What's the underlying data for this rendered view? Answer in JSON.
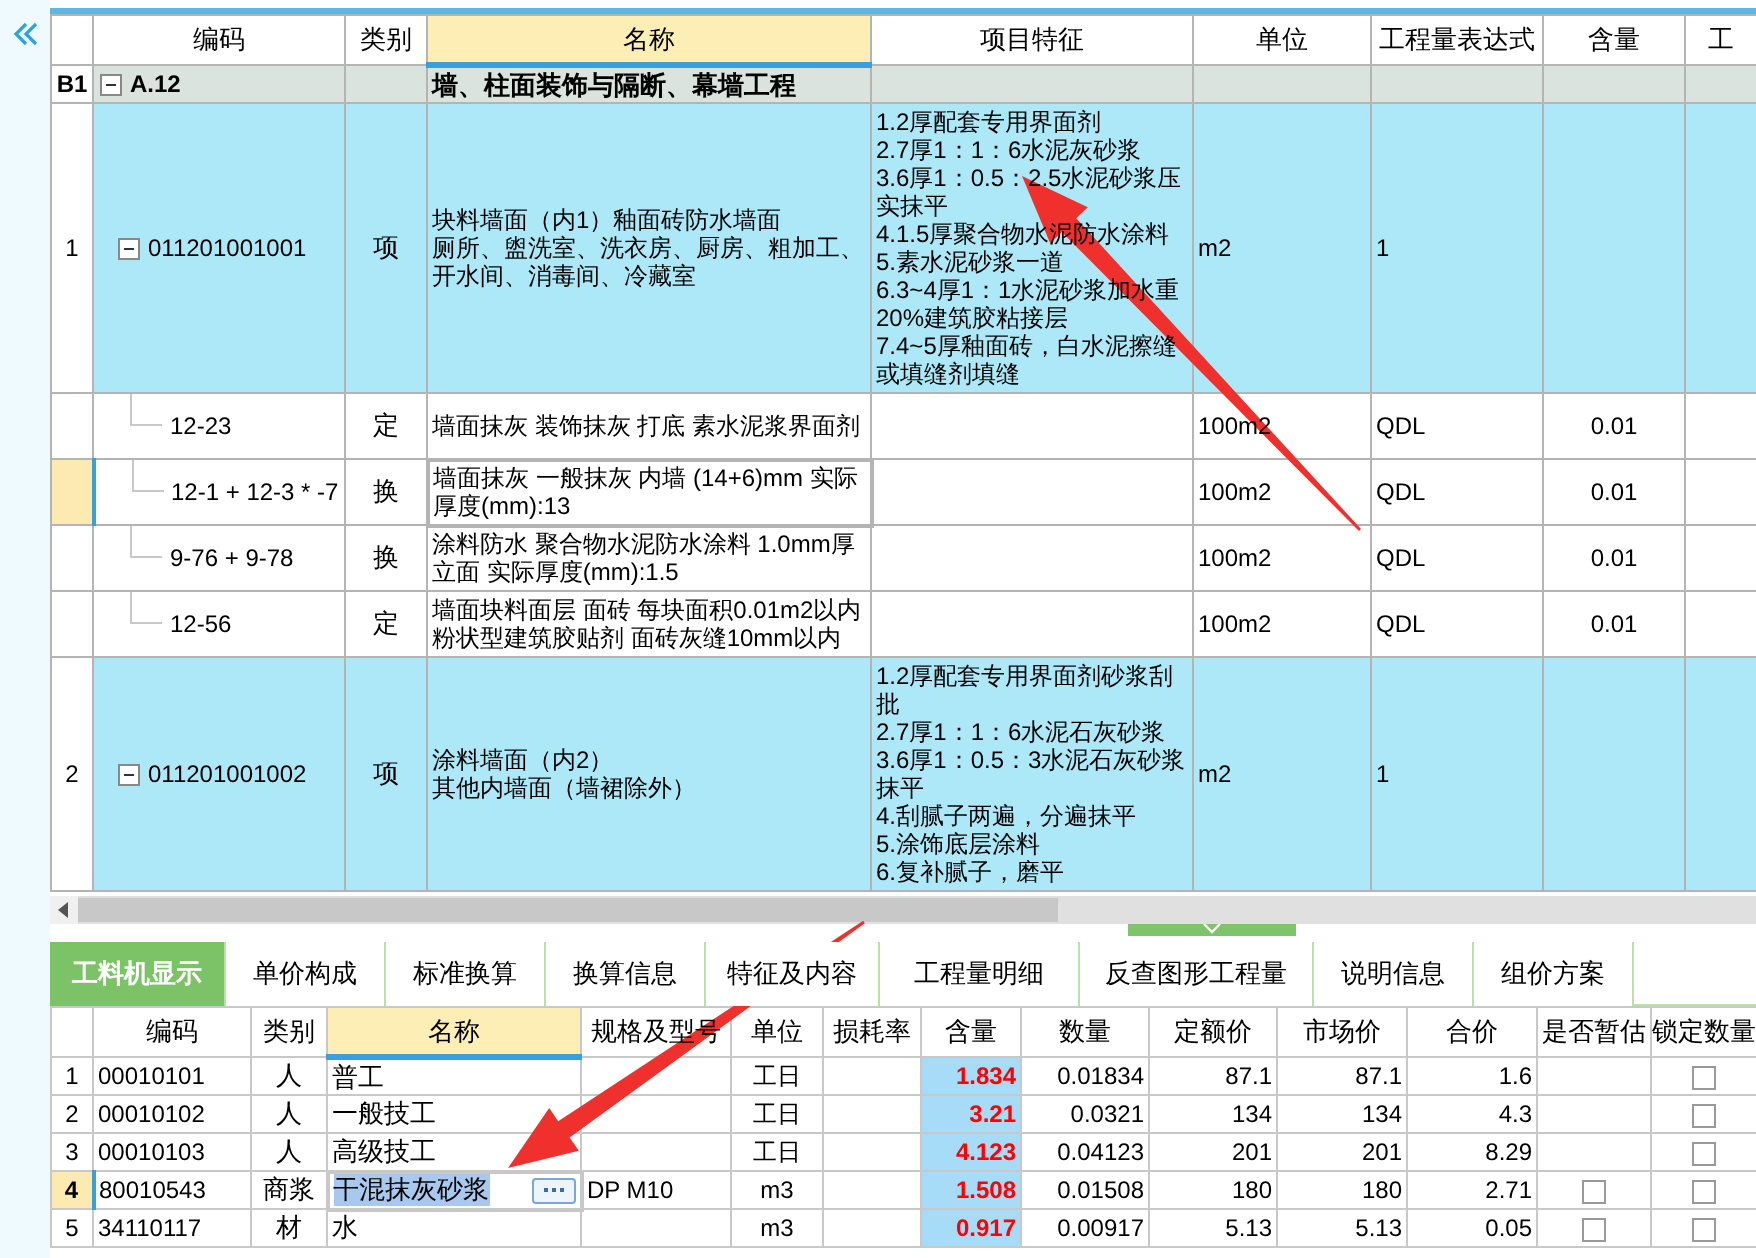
{
  "top_grid": {
    "columns": [
      {
        "selected": false
      },
      {
        "label": "编码",
        "selected": false
      },
      {
        "label": "类别",
        "selected": false
      },
      {
        "label": "名称",
        "selected": true
      },
      {
        "label": "项目特征",
        "selected": false
      },
      {
        "label": "单位",
        "selected": false
      },
      {
        "label": "工程量表达式",
        "selected": false
      },
      {
        "label": "含量",
        "selected": false
      },
      {
        "label": "工",
        "selected": false
      }
    ],
    "rows": [
      {
        "kind": "section",
        "number": "B1",
        "code": "A.12",
        "expanded": true,
        "type": "",
        "name": [
          "墙、柱面装饰与隔断、幕墙工程"
        ],
        "features": [],
        "unit": "",
        "expression": "",
        "content": "",
        "selected": false
      },
      {
        "kind": "item",
        "number": "1",
        "code": "011201001001",
        "expanded": true,
        "type": "项",
        "name": [
          "块料墙面（内1）釉面砖防水墙面",
          "厕所、盥洗室、洗衣房、厨房、粗加工、开水间、消毒间、冷藏室"
        ],
        "features": [
          "1.2厚配套专用界面剂",
          "2.7厚1：1：6水泥灰砂浆",
          "3.6厚1：0.5：2.5水泥砂浆压实抹平",
          "4.1.5厚聚合物水泥防水涂料",
          "5.素水泥砂浆一道",
          "6.3~4厚1：1水泥砂浆加水重20%建筑胶粘接层",
          "7.4~5厚釉面砖，白水泥擦缝或填缝剂填缝"
        ],
        "unit": "m2",
        "expression": "1",
        "content": "",
        "selected": false
      },
      {
        "kind": "sub",
        "number": "",
        "code": "12-23",
        "type": "定",
        "name": [
          "墙面抹灰 装饰抹灰 打底 素水泥浆界面剂"
        ],
        "features": [],
        "unit": "100m2",
        "expression": "QDL",
        "content": "0.01",
        "selected": false
      },
      {
        "kind": "sub",
        "number": "",
        "code": "12-1 + 12-3 * -7",
        "type": "换",
        "name": [
          "墙面抹灰 一般抹灰 内墙 (14+6)mm  实际厚度(mm):13"
        ],
        "features": [],
        "unit": "100m2",
        "expression": "QDL",
        "content": "0.01",
        "selected": true
      },
      {
        "kind": "sub",
        "number": "",
        "code": "9-76 + 9-78",
        "type": "换",
        "name": [
          "涂料防水 聚合物水泥防水涂料 1.0mm厚立面  实际厚度(mm):1.5"
        ],
        "features": [],
        "unit": "100m2",
        "expression": "QDL",
        "content": "0.01",
        "selected": false
      },
      {
        "kind": "sub",
        "number": "",
        "code": "12-56",
        "type": "定",
        "name": [
          "墙面块料面层 面砖 每块面积0.01m2以内粉状型建筑胶贴剂 面砖灰缝10mm以内"
        ],
        "features": [],
        "unit": "100m2",
        "expression": "QDL",
        "content": "0.01",
        "selected": false
      },
      {
        "kind": "item",
        "number": "2",
        "code": "011201001002",
        "expanded": true,
        "type": "项",
        "name": [
          "涂料墙面（内2）",
          "其他内墙面（墙裙除外）"
        ],
        "features": [
          "1.2厚配套专用界面剂砂浆刮批",
          "2.7厚1：1：6水泥石灰砂浆",
          "3.6厚1：0.5：3水泥石灰砂浆抹平",
          "4.刮腻子两遍，分遍抹平",
          "5.涂饰底层涂料",
          "6.复补腻子，磨平"
        ],
        "unit": "m2",
        "expression": "1",
        "content": "",
        "selected": false
      }
    ]
  },
  "bottom_tabs": [
    {
      "label": "工料机显示",
      "selected": true
    },
    {
      "label": "单价构成",
      "selected": false
    },
    {
      "label": "标准换算",
      "selected": false
    },
    {
      "label": "换算信息",
      "selected": false
    },
    {
      "label": "特征及内容",
      "selected": false
    },
    {
      "label": "工程量明细",
      "selected": false
    },
    {
      "label": "反查图形工程量",
      "selected": false
    },
    {
      "label": "说明信息",
      "selected": false
    },
    {
      "label": "组价方案",
      "selected": false
    }
  ],
  "resource_grid": {
    "columns": [
      {
        "selected": false
      },
      {
        "label": "编码",
        "selected": false
      },
      {
        "label": "类别",
        "selected": false
      },
      {
        "label": "名称",
        "selected": true
      },
      {
        "label": "规格及型号",
        "selected": false
      },
      {
        "label": "单位",
        "selected": false
      },
      {
        "label": "损耗率",
        "selected": false
      },
      {
        "label": "含量",
        "selected": false
      },
      {
        "label": "数量",
        "selected": false
      },
      {
        "label": "定额价",
        "selected": false
      },
      {
        "label": "市场价",
        "selected": false
      },
      {
        "label": "合价",
        "selected": false
      },
      {
        "label": "是否暂估",
        "selected": false
      },
      {
        "label": "锁定数量",
        "selected": false
      }
    ],
    "rows": [
      {
        "number": "1",
        "code": "00010101",
        "type": "人",
        "name": "普工",
        "spec": "",
        "unit": "工日",
        "content": "1.834",
        "quantity": "0.01834",
        "quota_price": "87.1",
        "market_price": "87.1",
        "total": "1.6",
        "locked": false,
        "selected": false
      },
      {
        "number": "2",
        "code": "00010102",
        "type": "人",
        "name": "一般技工",
        "spec": "",
        "unit": "工日",
        "content": "3.21",
        "quantity": "0.0321",
        "quota_price": "134",
        "market_price": "134",
        "total": "4.3",
        "locked": false,
        "selected": false
      },
      {
        "number": "3",
        "code": "00010103",
        "type": "人",
        "name": "高级技工",
        "spec": "",
        "unit": "工日",
        "content": "4.123",
        "quantity": "0.04123",
        "quota_price": "201",
        "market_price": "201",
        "total": "8.29",
        "locked": false,
        "selected": false
      },
      {
        "number": "4",
        "code": "80010543",
        "type": "商浆",
        "name": "干混抹灰砂浆",
        "spec": "DP M10",
        "unit": "m3",
        "content": "1.508",
        "quantity": "0.01508",
        "quota_price": "180",
        "market_price": "180",
        "total": "2.71",
        "provisional": false,
        "locked": false,
        "selected": true
      },
      {
        "number": "5",
        "code": "34110117",
        "type": "材",
        "name": "水",
        "spec": "",
        "unit": "m3",
        "content": "0.917",
        "quantity": "0.00917",
        "quota_price": "5.13",
        "market_price": "5.13",
        "total": "0.05",
        "provisional": false,
        "locked": false,
        "selected": false
      }
    ]
  }
}
